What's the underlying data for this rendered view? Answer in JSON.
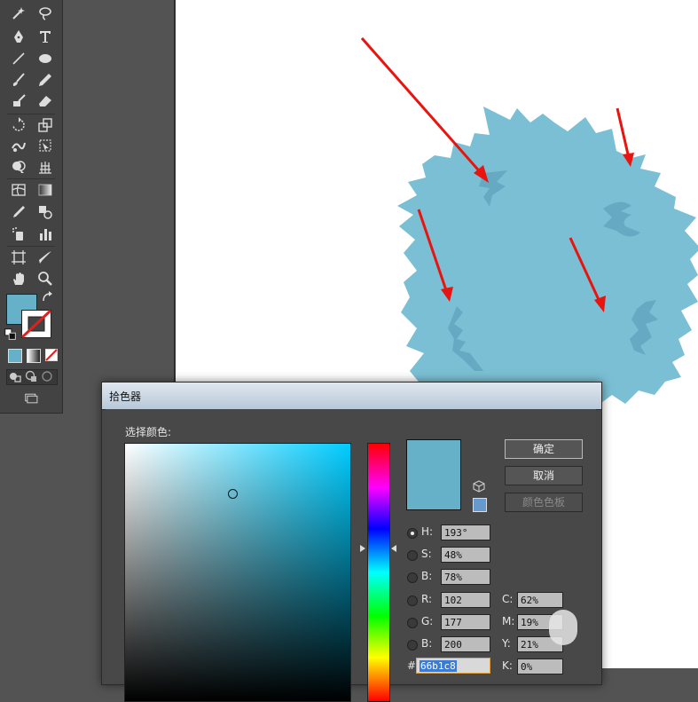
{
  "dialog": {
    "title": "拾色器",
    "select_color_label": "选择颜色:",
    "ok_button": "确定",
    "cancel_button": "取消",
    "swatches_button": "颜色色板",
    "hsb": [
      {
        "label": "H:",
        "value": "193°",
        "selected": true
      },
      {
        "label": "S:",
        "value": "48%",
        "selected": false
      },
      {
        "label": "B:",
        "value": "78%",
        "selected": false
      }
    ],
    "rgb": [
      {
        "label": "R:",
        "value": "102"
      },
      {
        "label": "G:",
        "value": "177"
      },
      {
        "label": "B:",
        "value": "200"
      }
    ],
    "cmyk": [
      {
        "label": "C:",
        "value": "62%"
      },
      {
        "label": "M:",
        "value": "19%"
      },
      {
        "label": "Y:",
        "value": "21%"
      },
      {
        "label": "K:",
        "value": "0%"
      }
    ],
    "hex_prefix": "#",
    "hex_value": "66b1c8",
    "current_color": "#66b1c8",
    "web_safe_color": "#6699cc",
    "spectrum_hue_color": "#00ccff"
  },
  "artwork": {
    "blob_color": "#7bbfd4",
    "shadow_color": "#66a9c2",
    "arrow_color": "#e8140f"
  },
  "tools": {
    "fill_color": "#66b1c8"
  }
}
